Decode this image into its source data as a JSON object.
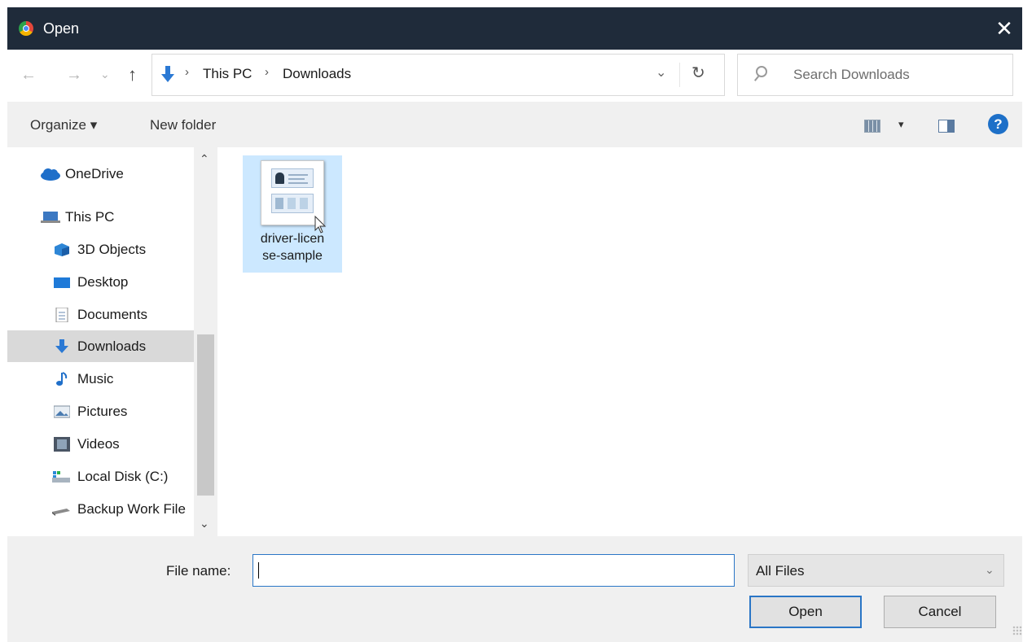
{
  "window": {
    "title": "Open",
    "close_glyph": "✕"
  },
  "nav": {
    "back_glyph": "←",
    "forward_glyph": "→",
    "recent_glyph": "⌄",
    "up_glyph": "↑"
  },
  "address": {
    "breadcrumbs": [
      "This PC",
      "Downloads"
    ],
    "separator": "›",
    "dropdown_glyph": "⌄",
    "refresh_glyph": "↻"
  },
  "search": {
    "placeholder": "Search Downloads"
  },
  "commands": {
    "organize": "Organize ▾",
    "new_folder": "New folder",
    "views_dropdown": "▾",
    "help": "?"
  },
  "sidebar": {
    "items": [
      {
        "label": "OneDrive",
        "icon": "cloud-icon"
      },
      {
        "label": "This PC",
        "icon": "computer-icon"
      },
      {
        "label": "3D Objects",
        "icon": "cube-icon"
      },
      {
        "label": "Desktop",
        "icon": "desktop-icon"
      },
      {
        "label": "Documents",
        "icon": "document-icon"
      },
      {
        "label": "Downloads",
        "icon": "download-icon",
        "selected": true
      },
      {
        "label": "Music",
        "icon": "music-icon"
      },
      {
        "label": "Pictures",
        "icon": "pictures-icon"
      },
      {
        "label": "Videos",
        "icon": "videos-icon"
      },
      {
        "label": "Local Disk (C:)",
        "icon": "disk-icon"
      },
      {
        "label": "Backup Work File",
        "icon": "drive-icon"
      }
    ],
    "scroll_up": "⌃",
    "scroll_down": "⌄"
  },
  "files": [
    {
      "name_line1": "driver-licen",
      "name_line2": "se-sample",
      "icon": "image-thumbnail-icon"
    }
  ],
  "footer": {
    "file_name_label": "File name:",
    "file_name_value": "",
    "file_type": "All Files",
    "dropdown_glyph": "⌄",
    "open_label": "Open",
    "cancel_label": "Cancel"
  },
  "colors": {
    "titlebar": "#1f2b3a",
    "selection": "#cce8ff",
    "accent": "#2a76c6",
    "download_arrow": "#2b79d4"
  }
}
